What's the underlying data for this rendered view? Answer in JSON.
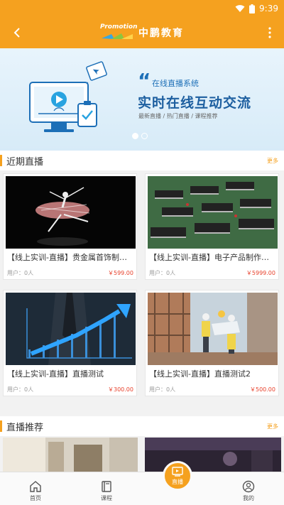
{
  "status_bar": {
    "time": "9:39"
  },
  "app_bar": {
    "logo_promo": "Promotion",
    "logo_text": "中鹏教育"
  },
  "banner": {
    "subtitle": "在线直播系统",
    "quote_mark": "“",
    "headline": "实时在线互动交流",
    "tags": "最新直播 / 热门直播 / 课程推荐",
    "dots": 2,
    "active_dot": 0
  },
  "sections": {
    "recent": {
      "title": "近期直播",
      "more": "更多"
    },
    "recommend": {
      "title": "直播推荐",
      "more": "更多"
    }
  },
  "cards": [
    {
      "title": "【线上实训-直播】贵金属首饰制作工艺",
      "users": "用户：0人",
      "price": "￥599.00"
    },
    {
      "title": "【线上实训-直播】电子产品制作与调试",
      "users": "用户：0人",
      "price": "￥5999.00"
    },
    {
      "title": "【线上实训-直播】直播测试",
      "users": "用户：0人",
      "price": "￥300.00"
    },
    {
      "title": "【线上实训-直播】直播测试2",
      "users": "用户：0人",
      "price": "￥500.00"
    }
  ],
  "bottom_nav": {
    "home": "首页",
    "courses": "课程",
    "live": "直播",
    "mine": "我的"
  },
  "colors": {
    "accent": "#f5a11f",
    "price": "#e8412c",
    "banner_blue": "#1d6fb7"
  }
}
